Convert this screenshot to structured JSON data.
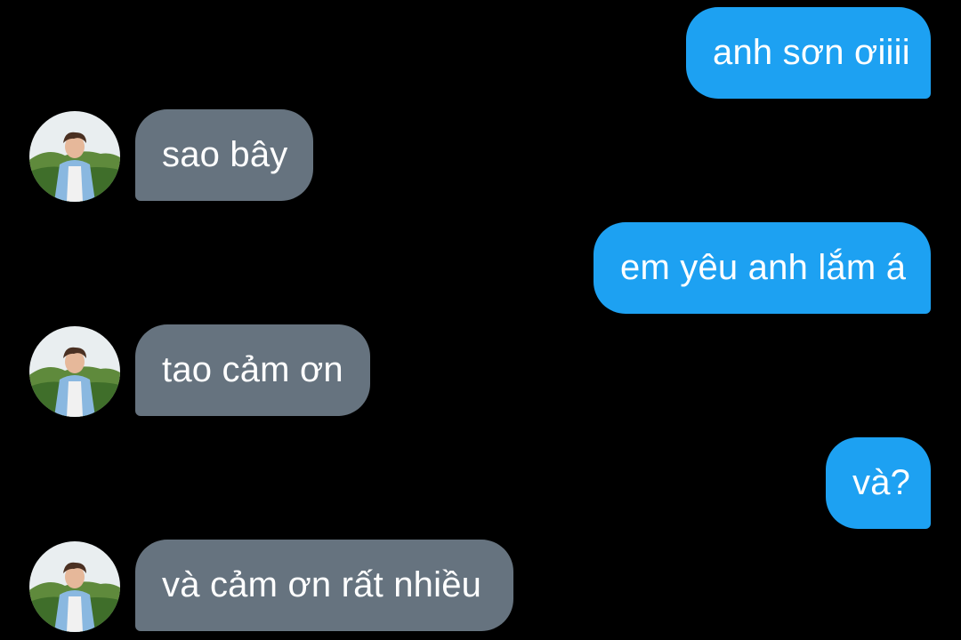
{
  "colors": {
    "background": "#000000",
    "outgoing_bubble": "#1da1f2",
    "incoming_bubble": "#66737f",
    "bubble_text": "#ffffff"
  },
  "messages": [
    {
      "direction": "outgoing",
      "text": "anh sơn ơiiii"
    },
    {
      "direction": "incoming",
      "text": "sao bây",
      "avatar": "contact-avatar-photo"
    },
    {
      "direction": "outgoing",
      "text": "em yêu anh lắm á"
    },
    {
      "direction": "incoming",
      "text": "tao cảm ơn",
      "avatar": "contact-avatar-photo"
    },
    {
      "direction": "outgoing",
      "text": "và?"
    },
    {
      "direction": "incoming",
      "text": "và cảm ơn rất nhiều",
      "avatar": "contact-avatar-photo"
    }
  ]
}
